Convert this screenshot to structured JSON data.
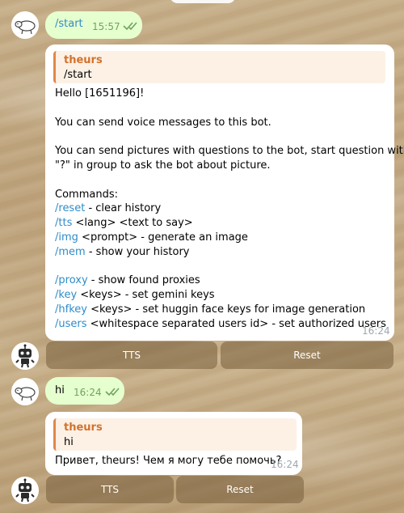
{
  "messages": {
    "m1": {
      "text": "/start",
      "time": "15:57",
      "read_status": "double-check-icon"
    },
    "m2": {
      "quote_name": "theurs",
      "quote_text": "/start",
      "time": "16:24",
      "greeting": "Hello [1651196]!",
      "voice": "You can send voice messages to this bot.",
      "pictures_1": "You can send pictures with questions to the bot, start question with",
      "pictures_2": "\"?\" in group to ask the bot about picture.",
      "commands_header": "Commands:",
      "commands": [
        {
          "cmd": "/reset",
          "desc": " - clear history"
        },
        {
          "cmd": "/tts",
          "desc": " <lang> <text to say>"
        },
        {
          "cmd": "/img",
          "desc": " <prompt> - generate an image"
        },
        {
          "cmd": "/mem",
          "desc": " - show your history"
        },
        {
          "cmd": "/proxy",
          "desc": " - show found proxies"
        },
        {
          "cmd": "/key",
          "desc": " <keys> - set gemini keys"
        },
        {
          "cmd": "/hfkey",
          "desc": " <keys> - set huggin face keys for image generation"
        },
        {
          "cmd": "/users",
          "desc": " <whitespace separated users id> - set authorized users"
        }
      ]
    },
    "m3": {
      "text": "hi",
      "time": "16:24",
      "read_status": "double-check-icon"
    },
    "m4": {
      "quote_name": "theurs",
      "quote_text": "hi",
      "text": "Привет, theurs! Чем я могу тебе помочь?",
      "time": "16:24"
    }
  },
  "keyboard1": {
    "tts": "TTS",
    "reset": "Reset"
  },
  "keyboard2": {
    "tts": "TTS",
    "reset": "Reset"
  },
  "colors": {
    "outgoing_bubble": "#e6ffcf",
    "incoming_bubble": "#ffffff",
    "link": "#2f8cc9",
    "quote_accent": "#e2874a",
    "read_check": "#6fa35f"
  }
}
